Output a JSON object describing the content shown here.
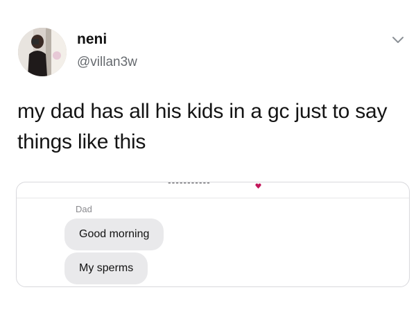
{
  "author": {
    "display_name": "neni",
    "handle": "@villan3w",
    "avatar_icon": "profile-photo"
  },
  "menu_icon": "chevron-down-icon",
  "tweet": {
    "text": "my dad has all his kids in a gc just to say things like this"
  },
  "embedded_chat": {
    "group_title": "▪▪▪▪▪▪▪▪▪▪▪",
    "heart_color": "#c2185b",
    "sender": "Dad",
    "messages": [
      {
        "text": "Good morning"
      },
      {
        "text": "My sperms"
      }
    ],
    "bubble_color": "#e9e9eb"
  }
}
